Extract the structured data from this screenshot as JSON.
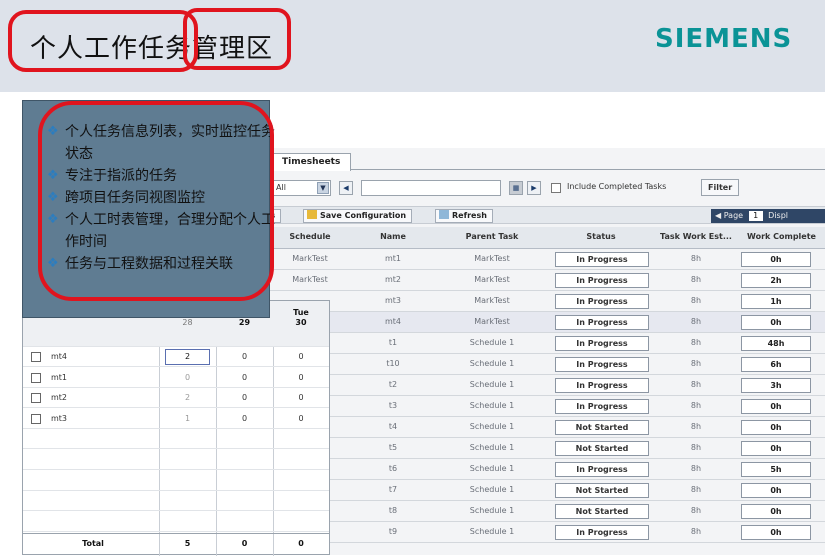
{
  "header": {
    "title": "个人工作任务管理区",
    "logo": "SIEMENS"
  },
  "overlay": {
    "items": [
      "个人任务信息列表，实时监控任务状态",
      "专注于指派的任务",
      "跨项目任务同视图监控",
      "个人工时表管理，合理分配个人工作时间",
      "任务与工程数据和过程关联"
    ]
  },
  "app": {
    "tab_label": "Timesheets",
    "filter": {
      "select_value": "All",
      "include_completed_label": "Include Completed Tasks",
      "filter_button": "Filter"
    },
    "toolbar": {
      "tasks_label": "ks",
      "save_config_label": "Save Configuration",
      "refresh_label": "Refresh",
      "page_label": "Page",
      "page_value": "1",
      "display_label": "Displ"
    },
    "columns": [
      "Schedule",
      "Name",
      "Parent Task",
      "Status",
      "Task Work Est...",
      "Work Complete"
    ],
    "rows": [
      {
        "schedule": "MarkTest",
        "name": "mt1",
        "parent": "MarkTest",
        "status": "In Progress",
        "est": "8h",
        "complete": "0h"
      },
      {
        "schedule": "MarkTest",
        "name": "mt2",
        "parent": "MarkTest",
        "status": "In Progress",
        "est": "8h",
        "complete": "2h"
      },
      {
        "schedule": "",
        "name": "mt3",
        "parent": "MarkTest",
        "status": "In Progress",
        "est": "8h",
        "complete": "1h"
      },
      {
        "schedule": "",
        "name": "mt4",
        "parent": "MarkTest",
        "status": "In Progress",
        "est": "8h",
        "complete": "0h"
      },
      {
        "schedule": "",
        "name": "t1",
        "parent": "Schedule 1",
        "status": "In Progress",
        "est": "8h",
        "complete": "48h"
      },
      {
        "schedule": "",
        "name": "t10",
        "parent": "Schedule 1",
        "status": "In Progress",
        "est": "8h",
        "complete": "6h"
      },
      {
        "schedule": "",
        "name": "t2",
        "parent": "Schedule 1",
        "status": "In Progress",
        "est": "8h",
        "complete": "3h"
      },
      {
        "schedule": "",
        "name": "t3",
        "parent": "Schedule 1",
        "status": "In Progress",
        "est": "8h",
        "complete": "0h"
      },
      {
        "schedule": "",
        "name": "t4",
        "parent": "Schedule 1",
        "status": "Not Started",
        "est": "8h",
        "complete": "0h"
      },
      {
        "schedule": "",
        "name": "t5",
        "parent": "Schedule 1",
        "status": "Not Started",
        "est": "8h",
        "complete": "0h"
      },
      {
        "schedule": "",
        "name": "t6",
        "parent": "Schedule 1",
        "status": "In Progress",
        "est": "8h",
        "complete": "5h"
      },
      {
        "schedule": "",
        "name": "t7",
        "parent": "Schedule 1",
        "status": "Not Started",
        "est": "8h",
        "complete": "0h"
      },
      {
        "schedule": "",
        "name": "t8",
        "parent": "Schedule 1",
        "status": "Not Started",
        "est": "8h",
        "complete": "0h"
      },
      {
        "schedule": "",
        "name": "t9",
        "parent": "Schedule 1",
        "status": "In Progress",
        "est": "8h",
        "complete": "0h"
      }
    ]
  },
  "timesheet": {
    "col_headers": [
      "28",
      "29",
      "Tue",
      "30"
    ],
    "rows": [
      {
        "name": "mt4",
        "d28": "2",
        "d29": "0",
        "d30": "0"
      },
      {
        "name": "mt1",
        "d28": "0",
        "d29": "0",
        "d30": "0"
      },
      {
        "name": "mt2",
        "d28": "2",
        "d29": "0",
        "d30": "0"
      },
      {
        "name": "mt3",
        "d28": "1",
        "d29": "0",
        "d30": "0"
      }
    ],
    "total_label": "Total",
    "total_28": "5",
    "total_29": "0",
    "total_30": "0"
  }
}
